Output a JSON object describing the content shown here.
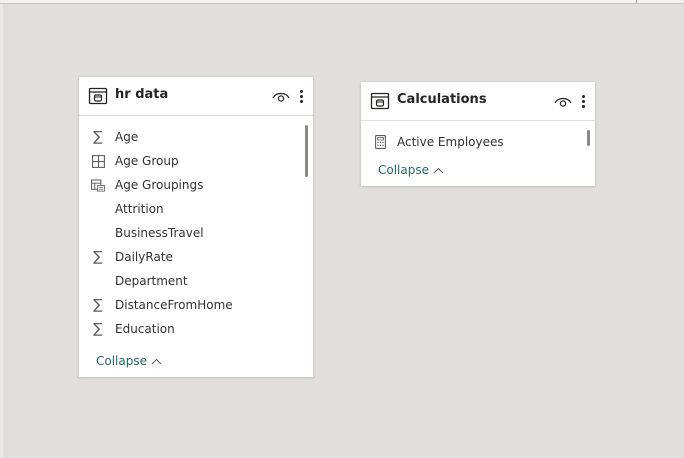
{
  "tables": [
    {
      "title": "hr data",
      "fields": [
        {
          "name": "Age",
          "icon": "sigma-icon"
        },
        {
          "name": "Age Group",
          "icon": "hierarchy-table-icon"
        },
        {
          "name": "Age Groupings",
          "icon": "group-icon"
        },
        {
          "name": "Attrition",
          "icon": ""
        },
        {
          "name": "BusinessTravel",
          "icon": ""
        },
        {
          "name": "DailyRate",
          "icon": "sigma-icon"
        },
        {
          "name": "Department",
          "icon": ""
        },
        {
          "name": "DistanceFromHome",
          "icon": "sigma-icon"
        },
        {
          "name": "Education",
          "icon": "sigma-icon"
        }
      ],
      "collapse_label": "Collapse"
    },
    {
      "title": "Calculations",
      "fields": [
        {
          "name": "Active Employees",
          "icon": "calculator-icon"
        }
      ],
      "collapse_label": "Collapse"
    }
  ],
  "colors": {
    "canvas": "#e1dfdd",
    "card": "#ffffff",
    "link": "#1f6a63"
  }
}
